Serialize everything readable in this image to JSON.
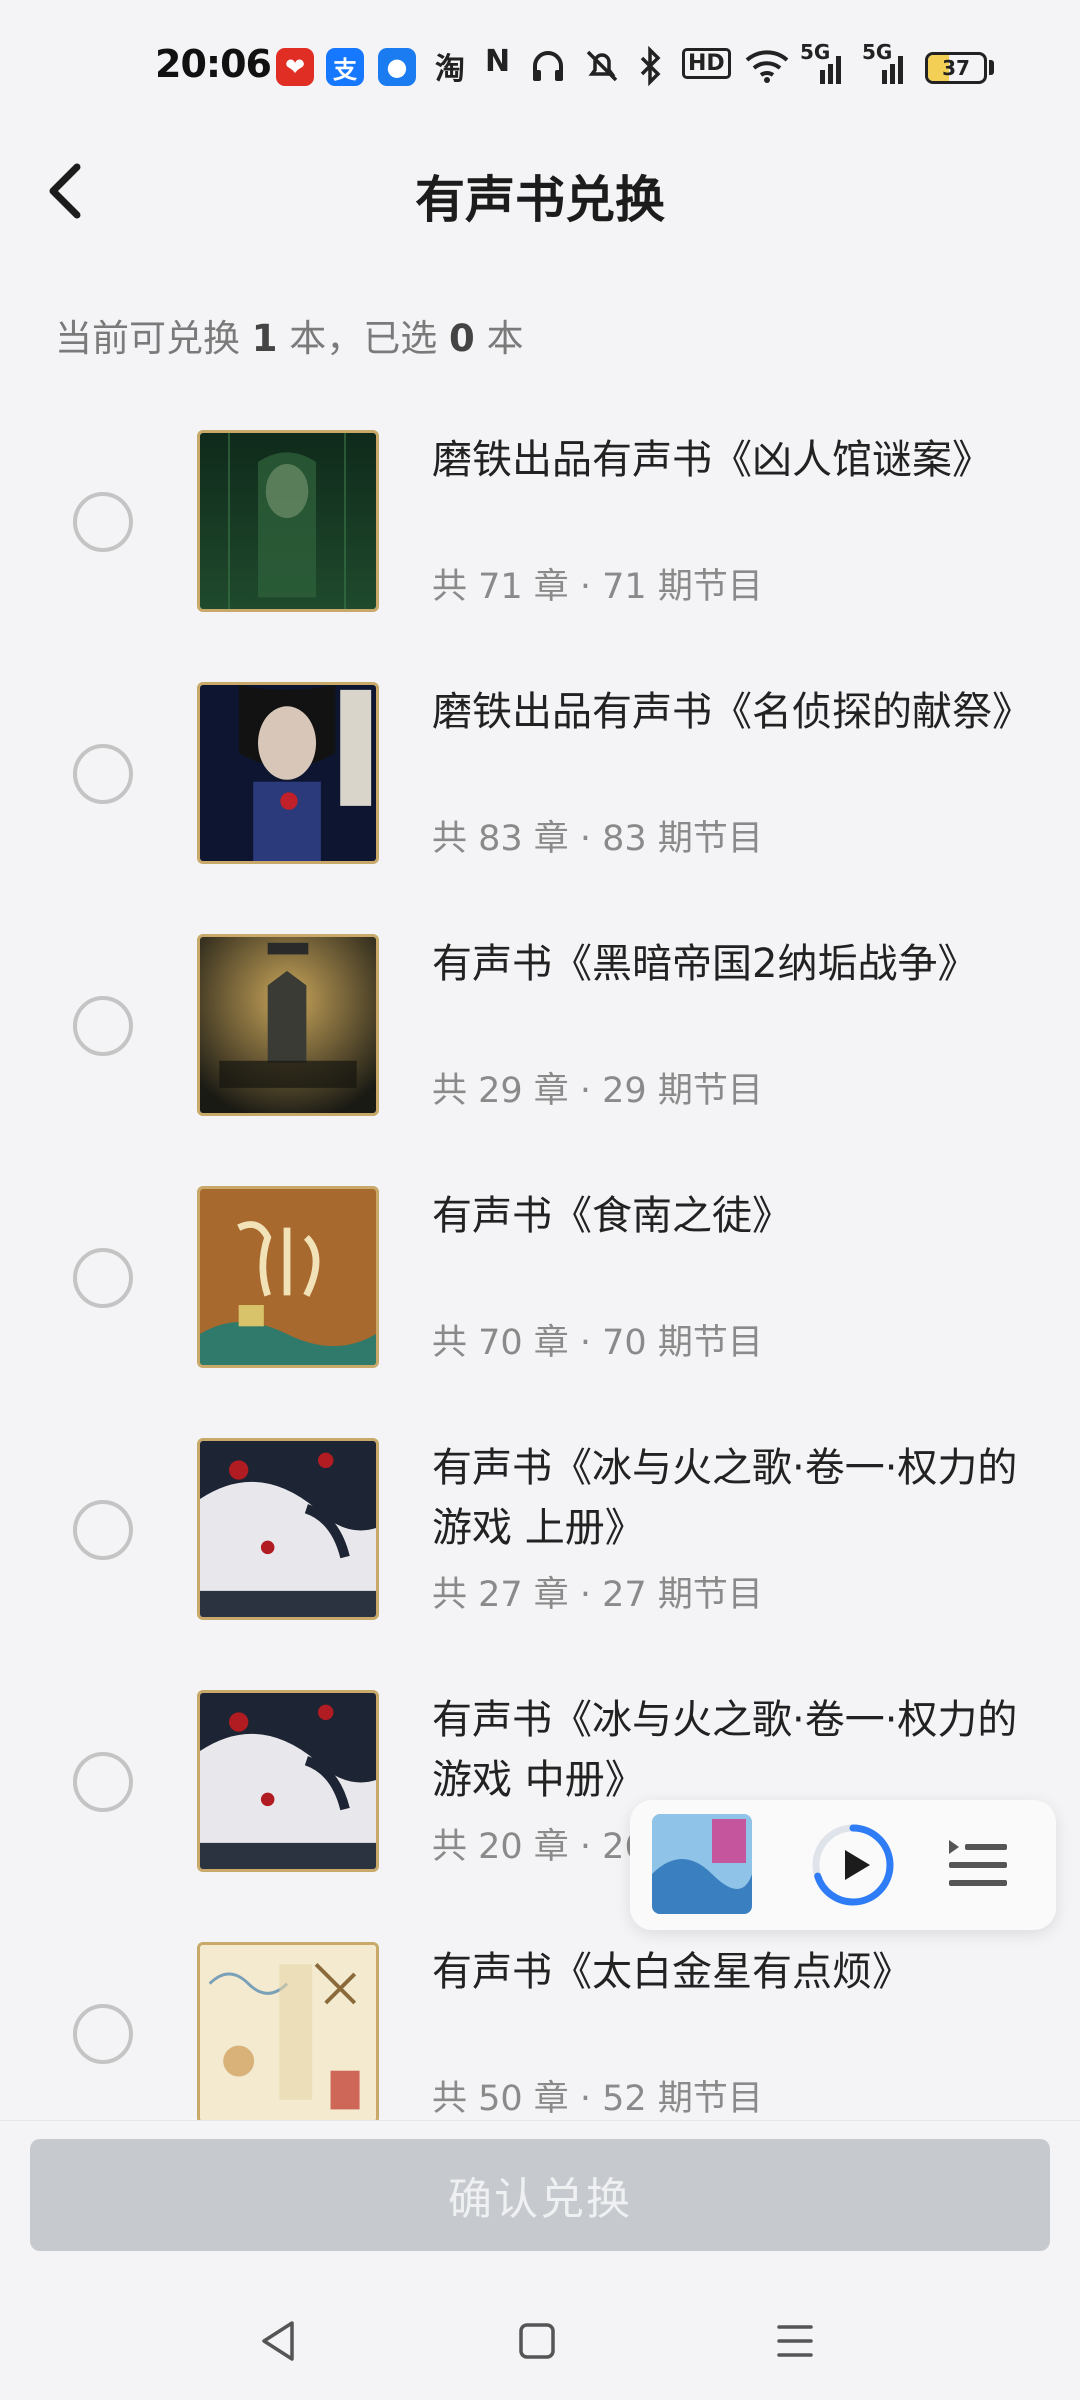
{
  "status_bar": {
    "time": "20:06",
    "apps": [
      {
        "icon": "pinduoduo-icon",
        "glyph": "❤",
        "color": "#e02e24"
      },
      {
        "icon": "alipay-icon",
        "glyph": "支",
        "color": "#1677ff"
      },
      {
        "icon": "app-icon",
        "glyph": "●",
        "color": "#1a7cf0"
      }
    ],
    "indicators": [
      "淘",
      "N",
      "HD",
      "5G",
      "5G"
    ],
    "battery": "37"
  },
  "header": {
    "title": "有声书兑换"
  },
  "summary": {
    "prefix": "当前可兑换",
    "available": "1",
    "mid": "本，已选",
    "selected": "0",
    "suffix": "本"
  },
  "books": [
    {
      "title": "磨铁出品有声书《凶人馆谜案》",
      "meta": "共 71 章 · 71 期节目"
    },
    {
      "title": "磨铁出品有声书《名侦探的献祭》",
      "meta": "共 83 章 · 83 期节目"
    },
    {
      "title": "有声书《黑暗帝国2纳垢战争》",
      "meta": "共 29 章 · 29 期节目"
    },
    {
      "title": "有声书《食南之徒》",
      "meta": "共 70 章 · 70 期节目"
    },
    {
      "title": "有声书《冰与火之歌·卷一·权力的游戏 上册》",
      "meta": "共 27 章 · 27 期节目"
    },
    {
      "title": "有声书《冰与火之歌·卷一·权力的游戏 中册》",
      "meta": "共 20 章 · 26"
    },
    {
      "title": "有声书《太白金星有点烦》",
      "meta": "共 50 章 · 52 期节目"
    }
  ],
  "mini_player": {
    "progress": 0.7
  },
  "footer": {
    "confirm_label": "确认兑换"
  },
  "colors": {
    "accent": "#2e7cf6",
    "disabled_button": "#c6c9cd"
  }
}
